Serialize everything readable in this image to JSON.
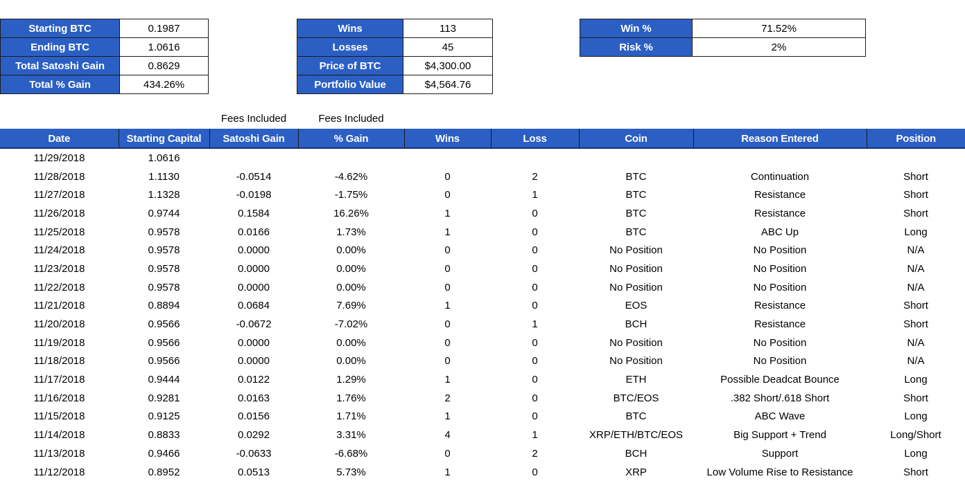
{
  "summary": {
    "btc_card": {
      "name": "btc-summary",
      "rows": [
        {
          "label": "Starting BTC",
          "value": "0.1987"
        },
        {
          "label": "Ending BTC",
          "value": "1.0616"
        },
        {
          "label": "Total Satoshi Gain",
          "value": "0.8629"
        },
        {
          "label": "Total % Gain",
          "value": "434.26%"
        }
      ]
    },
    "trades_card": {
      "name": "trades-summary",
      "rows": [
        {
          "label": "Wins",
          "value": "113"
        },
        {
          "label": "Losses",
          "value": "45"
        },
        {
          "label": "Price of BTC",
          "value": "$4,300.00"
        },
        {
          "label": "Portfolio Value",
          "value": "$4,564.76"
        }
      ]
    },
    "risk_card": {
      "name": "risk-summary",
      "rows": [
        {
          "label": "Win %",
          "value": "71.52%"
        },
        {
          "label": "Risk %",
          "value": "2%"
        }
      ]
    }
  },
  "annotations": {
    "fees_satoshi": "Fees Included",
    "fees_pct": "Fees Included"
  },
  "ledger": {
    "headers": [
      "Date",
      "Starting Capital",
      "Satoshi Gain",
      "% Gain",
      "Wins",
      "Loss",
      "Coin",
      "Reason Entered",
      "Position"
    ],
    "rows": [
      [
        "11/29/2018",
        "1.0616",
        "",
        "",
        "",
        "",
        "",
        "",
        ""
      ],
      [
        "11/28/2018",
        "1.1130",
        "-0.0514",
        "-4.62%",
        "0",
        "2",
        "BTC",
        "Continuation",
        "Short"
      ],
      [
        "11/27/2018",
        "1.1328",
        "-0.0198",
        "-1.75%",
        "0",
        "1",
        "BTC",
        "Resistance",
        "Short"
      ],
      [
        "11/26/2018",
        "0.9744",
        "0.1584",
        "16.26%",
        "1",
        "0",
        "BTC",
        "Resistance",
        "Short"
      ],
      [
        "11/25/2018",
        "0.9578",
        "0.0166",
        "1.73%",
        "1",
        "0",
        "BTC",
        "ABC Up",
        "Long"
      ],
      [
        "11/24/2018",
        "0.9578",
        "0.0000",
        "0.00%",
        "0",
        "0",
        "No Position",
        "No Position",
        "N/A"
      ],
      [
        "11/23/2018",
        "0.9578",
        "0.0000",
        "0.00%",
        "0",
        "0",
        "No Position",
        "No Position",
        "N/A"
      ],
      [
        "11/22/2018",
        "0.9578",
        "0.0000",
        "0.00%",
        "0",
        "0",
        "No Position",
        "No Position",
        "N/A"
      ],
      [
        "11/21/2018",
        "0.8894",
        "0.0684",
        "7.69%",
        "1",
        "0",
        "EOS",
        "Resistance",
        "Short"
      ],
      [
        "11/20/2018",
        "0.9566",
        "-0.0672",
        "-7.02%",
        "0",
        "1",
        "BCH",
        "Resistance",
        "Short"
      ],
      [
        "11/19/2018",
        "0.9566",
        "0.0000",
        "0.00%",
        "0",
        "0",
        "No Position",
        "No Position",
        "N/A"
      ],
      [
        "11/18/2018",
        "0.9566",
        "0.0000",
        "0.00%",
        "0",
        "0",
        "No Position",
        "No Position",
        "N/A"
      ],
      [
        "11/17/2018",
        "0.9444",
        "0.0122",
        "1.29%",
        "1",
        "0",
        "ETH",
        "Possible Deadcat Bounce",
        "Long"
      ],
      [
        "11/16/2018",
        "0.9281",
        "0.0163",
        "1.76%",
        "2",
        "0",
        "BTC/EOS",
        ".382 Short/.618 Short",
        "Short"
      ],
      [
        "11/15/2018",
        "0.9125",
        "0.0156",
        "1.71%",
        "1",
        "0",
        "BTC",
        "ABC Wave",
        "Long"
      ],
      [
        "11/14/2018",
        "0.8833",
        "0.0292",
        "3.31%",
        "4",
        "1",
        "XRP/ETH/BTC/EOS",
        "Big Support + Trend",
        "Long/Short"
      ],
      [
        "11/13/2018",
        "0.9466",
        "-0.0633",
        "-6.68%",
        "0",
        "2",
        "BCH",
        "Support",
        "Long"
      ],
      [
        "11/12/2018",
        "0.8952",
        "0.0513",
        "5.73%",
        "1",
        "0",
        "XRP",
        "Low Volume Rise to Resistance",
        "Short"
      ]
    ]
  },
  "colors": {
    "header_blue": "#2b5fc4",
    "header_text": "#ffffff",
    "border": "#1a1a1a",
    "background": "#ffffff"
  }
}
